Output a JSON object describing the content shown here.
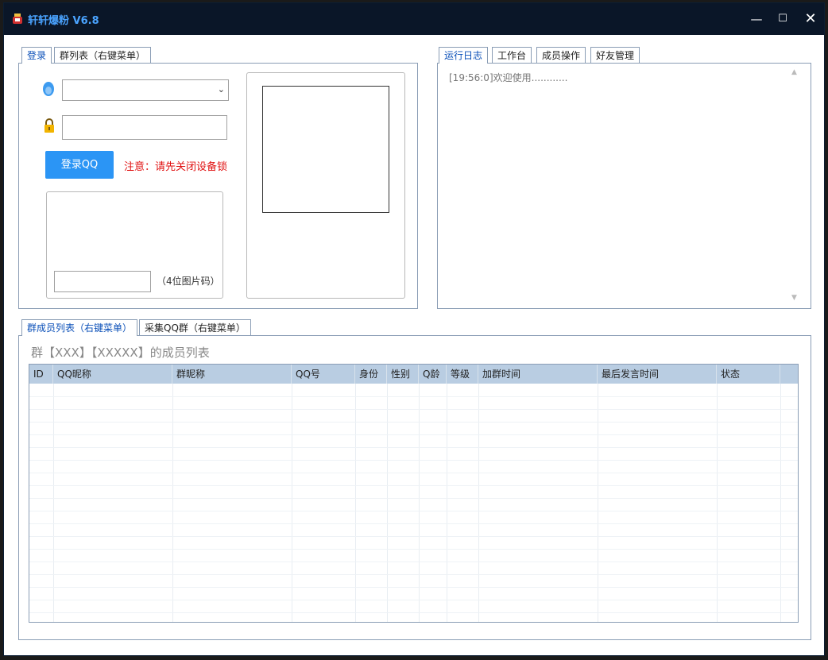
{
  "window": {
    "title": "轩轩爆粉 V6.8",
    "controls": {
      "minimize": "—",
      "maximize": "☐",
      "close": "✕"
    }
  },
  "login_panel": {
    "tabs": [
      {
        "label": "登录",
        "active": true
      },
      {
        "label": "群列表（右键菜单）",
        "active": false
      }
    ],
    "account_icon": "qq-penguin-icon",
    "account_select": {
      "value": ""
    },
    "password_icon": "lock-icon",
    "password_input": {
      "value": ""
    },
    "login_button": "登录QQ",
    "notice": "注意：请先关闭设备锁",
    "captcha_input": {
      "value": ""
    },
    "captcha_label": "（4位图片码）"
  },
  "log_panel": {
    "tabs": [
      {
        "label": "运行日志",
        "active": true
      },
      {
        "label": "工作台",
        "active": false
      },
      {
        "label": "成员操作",
        "active": false
      },
      {
        "label": "好友管理",
        "active": false
      }
    ],
    "lines": [
      "[19:56:0]欢迎使用............"
    ]
  },
  "member_panel": {
    "tabs": [
      {
        "label": "群成员列表（右键菜单）",
        "active": true
      },
      {
        "label": "采集QQ群（右键菜单）",
        "active": false
      }
    ],
    "title": "群【XXX】【XXXXX】的成员列表",
    "columns": [
      "ID",
      "QQ昵称",
      "群昵称",
      "QQ号",
      "身份",
      "性别",
      "Q龄",
      "等级",
      "加群时间",
      "最后发言时间",
      "状态"
    ],
    "rows": []
  },
  "colors": {
    "titlebar": "#0a1628",
    "title_text": "#4aa3ff",
    "login_button": "#2b95f5",
    "notice": "#e01010",
    "grid_header": "#b9cde2",
    "active_tab_text": "#0a4fb8"
  }
}
